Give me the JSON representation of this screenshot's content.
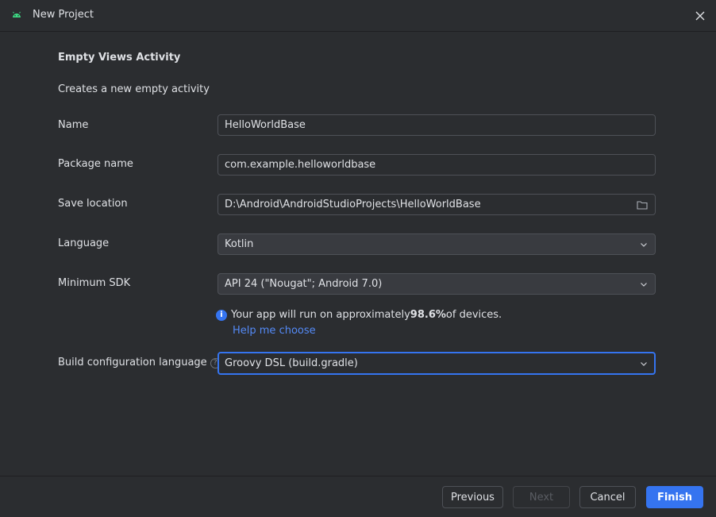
{
  "window": {
    "title": "New Project"
  },
  "form": {
    "heading": "Empty Views Activity",
    "description": "Creates a new empty activity",
    "name": {
      "label": "Name",
      "value": "HelloWorldBase"
    },
    "package": {
      "label": "Package name",
      "value": "com.example.helloworldbase"
    },
    "save_location": {
      "label": "Save location",
      "value": "D:\\Android\\AndroidStudioProjects\\HelloWorldBase"
    },
    "language": {
      "label": "Language",
      "value": "Kotlin"
    },
    "min_sdk": {
      "label": "Minimum SDK",
      "value": "API 24 (\"Nougat\"; Android 7.0)"
    },
    "info": {
      "prefix": "Your app will run on approximately ",
      "percent": "98.6%",
      "suffix": " of devices."
    },
    "help_link": "Help me choose",
    "build_config": {
      "label": "Build configuration language",
      "value": "Groovy DSL (build.gradle)"
    }
  },
  "footer": {
    "previous": "Previous",
    "next": "Next",
    "cancel": "Cancel",
    "finish": "Finish"
  },
  "colors": {
    "accent": "#3574f0",
    "background": "#2b2d30",
    "link": "#548af7",
    "android_green": "#3ddc84"
  }
}
